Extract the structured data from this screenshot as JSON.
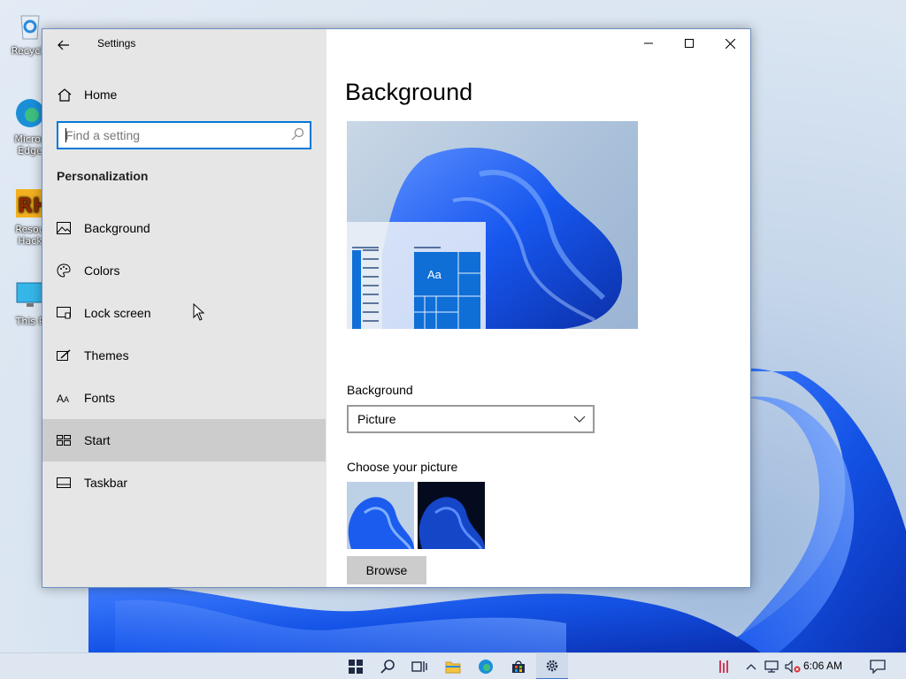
{
  "desktop": {
    "icons": [
      {
        "label": "Recycle",
        "icon": "recycle-bin-icon"
      },
      {
        "label": "Micros Edge",
        "icon": "edge-icon"
      },
      {
        "label": "Resou Hack",
        "icon": "resource-hacker-icon"
      },
      {
        "label": "This P",
        "icon": "monitor-icon"
      }
    ]
  },
  "window": {
    "title": "Settings",
    "controls": {
      "minimize": "minimize-icon",
      "maximize": "maximize-icon",
      "close": "close-icon"
    }
  },
  "sidebar": {
    "home_label": "Home",
    "search_placeholder": "Find a setting",
    "section_title": "Personalization",
    "items": [
      {
        "label": "Background",
        "icon": "picture-icon"
      },
      {
        "label": "Colors",
        "icon": "palette-icon"
      },
      {
        "label": "Lock screen",
        "icon": "lock-screen-icon"
      },
      {
        "label": "Themes",
        "icon": "brush-icon"
      },
      {
        "label": "Fonts",
        "icon": "font-icon"
      },
      {
        "label": "Start",
        "icon": "start-layout-icon",
        "active": true
      },
      {
        "label": "Taskbar",
        "icon": "taskbar-icon"
      }
    ]
  },
  "content": {
    "title": "Background",
    "preview_tile_text": "Aa",
    "background_label": "Background",
    "background_value": "Picture",
    "choose_label": "Choose your picture",
    "browse_label": "Browse"
  },
  "taskbar": {
    "buttons": [
      "start-icon",
      "search-icon",
      "task-view-icon",
      "file-explorer-icon",
      "edge-icon",
      "store-icon",
      "settings-icon"
    ],
    "clock": "6:06 AM",
    "accent": "#0078d7"
  }
}
